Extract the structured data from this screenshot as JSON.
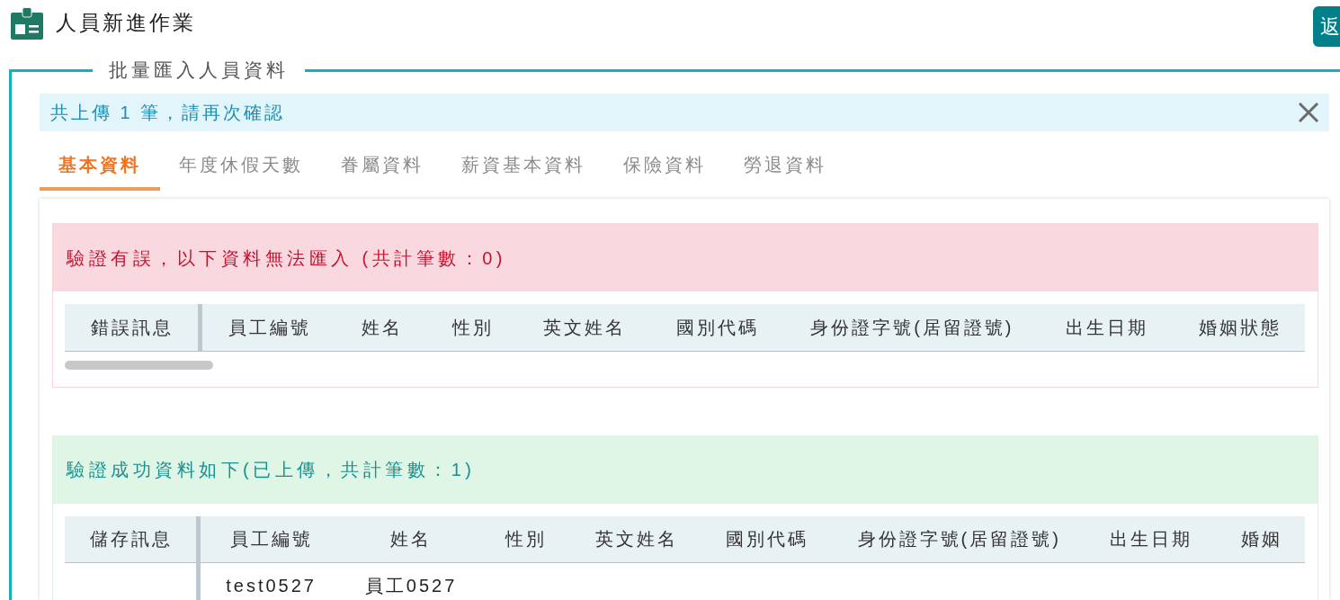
{
  "header": {
    "title": "人員新進作業",
    "back_button": "返"
  },
  "import_section": {
    "legend": "批量匯入人員資料",
    "notice": "共上傳 1 筆，請再次確認",
    "tabs": [
      {
        "label": "基本資料",
        "selected": true
      },
      {
        "label": "年度休假天數",
        "selected": false
      },
      {
        "label": "眷屬資料",
        "selected": false
      },
      {
        "label": "薪資基本資料",
        "selected": false
      },
      {
        "label": "保險資料",
        "selected": false
      },
      {
        "label": "勞退資料",
        "selected": false
      }
    ],
    "panels": [
      {
        "kind": "error",
        "title": "驗證有誤，以下資料無法匯入 (共計筆數：0)",
        "columns": [
          "錯誤訊息",
          "員工編號",
          "姓名",
          "性別",
          "英文姓名",
          "國別代碼",
          "身份證字號(居留證號)",
          "出生日期",
          "婚姻狀態"
        ]
      },
      {
        "kind": "success",
        "title": "驗證成功資料如下(已上傳，共計筆數：1)",
        "columns": [
          "儲存訊息",
          "員工編號",
          "姓名",
          "性別",
          "英文姓名",
          "國別代碼",
          "身份證字號(居留證號)",
          "出生日期",
          "婚姻"
        ],
        "rows": [
          {
            "cells": [
              "",
              "test0527",
              "員工0527"
            ]
          }
        ]
      }
    ]
  }
}
